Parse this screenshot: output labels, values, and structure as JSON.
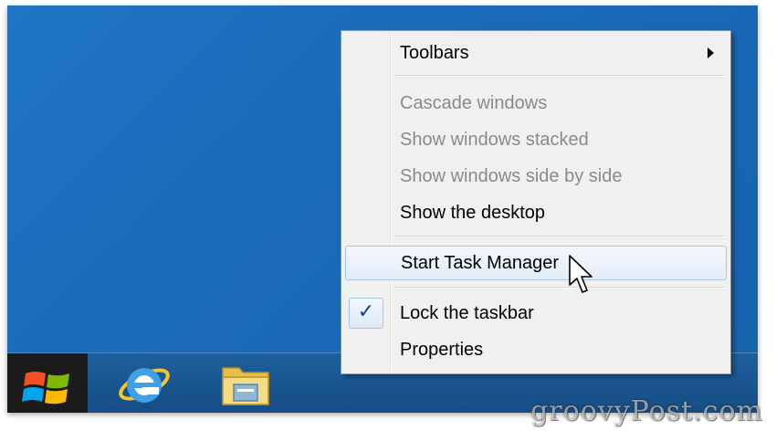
{
  "context_menu": {
    "toolbars": "Toolbars",
    "cascade": "Cascade windows",
    "stacked": "Show windows stacked",
    "side_by_side": "Show windows side by side",
    "show_desktop": "Show the desktop",
    "task_manager": "Start Task Manager",
    "lock_taskbar": "Lock the taskbar",
    "lock_checked": "✓",
    "properties": "Properties"
  },
  "taskbar": {
    "pinned": [
      "start-button",
      "internet-explorer-icon",
      "file-explorer-icon"
    ]
  },
  "watermark": "groovyPost.com",
  "colors": {
    "desktop": "#1a6bb9",
    "taskbar": "#1a5690",
    "menu_bg": "#f0f0f0",
    "hover_border": "#a8c5e6",
    "disabled_text": "#8a8a8a"
  }
}
